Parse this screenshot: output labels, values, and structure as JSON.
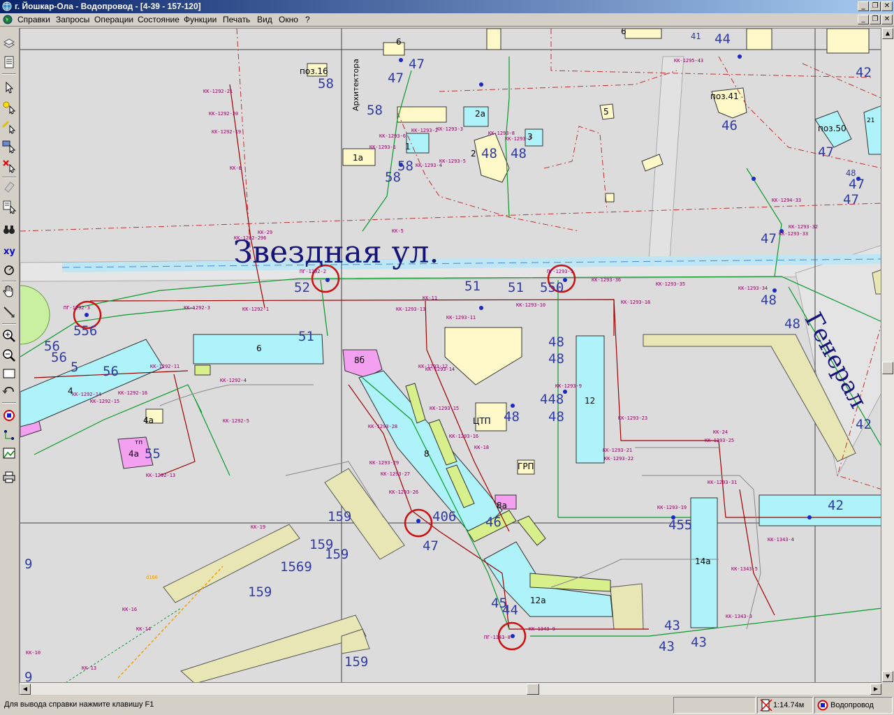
{
  "window": {
    "title": "г. Йошкар-Ола - Водопровод - [4-39 - 157-120]",
    "minimize_glyph": "_",
    "restore_glyph": "❐",
    "close_glyph": "✕"
  },
  "menu": {
    "items": [
      {
        "label": "Справки"
      },
      {
        "label": "Запросы"
      },
      {
        "label": "Операции"
      },
      {
        "label": "Состояние"
      },
      {
        "label": "Функции"
      },
      {
        "label": "Печать"
      },
      {
        "label": "Вид"
      },
      {
        "label": "Окно"
      },
      {
        "label": "?"
      }
    ]
  },
  "toolbar": {
    "tools": [
      {
        "name": "layers-tool-icon"
      },
      {
        "name": "document-tool-icon"
      },
      {
        "name": "pointer-tool-icon"
      },
      {
        "name": "select-point-tool-icon"
      },
      {
        "name": "select-line-tool-icon"
      },
      {
        "name": "select-area-tool-icon"
      },
      {
        "name": "select-delete-tool-icon"
      },
      {
        "name": "eraser-tool-icon"
      },
      {
        "name": "properties-tool-icon"
      },
      {
        "name": "binoculars-tool-icon"
      },
      {
        "name": "xy-coordinates-tool-icon",
        "text": "xy"
      },
      {
        "name": "measure-tool-icon"
      },
      {
        "name": "pan-hand-tool-icon"
      },
      {
        "name": "ruler-tool-icon"
      },
      {
        "name": "zoom-in-tool-icon"
      },
      {
        "name": "zoom-out-tool-icon"
      },
      {
        "name": "zoom-window-tool-icon"
      },
      {
        "name": "undo-zoom-tool-icon"
      },
      {
        "name": "network-node-tool-icon"
      },
      {
        "name": "network-trace-tool-icon"
      },
      {
        "name": "raster-image-tool-icon"
      },
      {
        "name": "print-tool-icon"
      }
    ]
  },
  "map": {
    "streets": [
      {
        "text": "Звездная ул."
      },
      {
        "text": "Генерал"
      },
      {
        "text": "Архитектора"
      }
    ],
    "buildings": [
      {
        "text": "6"
      },
      {
        "text": "6"
      },
      {
        "text": "поз.16"
      },
      {
        "text": "1а"
      },
      {
        "text": "1"
      },
      {
        "text": "2а"
      },
      {
        "text": "2"
      },
      {
        "text": "3"
      },
      {
        "text": "5"
      },
      {
        "text": "поз.41"
      },
      {
        "text": "поз.50"
      },
      {
        "text": "21"
      },
      {
        "text": "6"
      },
      {
        "text": "4"
      },
      {
        "text": "4а"
      },
      {
        "text": "4а"
      },
      {
        "text": "тп"
      },
      {
        "text": "8б"
      },
      {
        "text": "8"
      },
      {
        "text": "ЦТП"
      },
      {
        "text": "ГРП"
      },
      {
        "text": "8а"
      },
      {
        "text": "12"
      },
      {
        "text": "14а"
      },
      {
        "text": "12а"
      },
      {
        "text": "42"
      }
    ],
    "plot_numbers": [
      {
        "text": "47"
      },
      {
        "text": "47"
      },
      {
        "text": "58"
      },
      {
        "text": "58"
      },
      {
        "text": "58"
      },
      {
        "text": "48"
      },
      {
        "text": "48"
      },
      {
        "text": "46"
      },
      {
        "text": "47"
      },
      {
        "text": "47"
      },
      {
        "text": "47"
      },
      {
        "text": "47"
      },
      {
        "text": "52"
      },
      {
        "text": "51"
      },
      {
        "text": "51"
      },
      {
        "text": "550"
      },
      {
        "text": "48"
      },
      {
        "text": "48"
      },
      {
        "text": "48"
      },
      {
        "text": "48"
      },
      {
        "text": "448"
      },
      {
        "text": "48"
      },
      {
        "text": "48"
      },
      {
        "text": "42"
      },
      {
        "text": "51"
      },
      {
        "text": "56"
      },
      {
        "text": "556"
      },
      {
        "text": "56"
      },
      {
        "text": "5"
      },
      {
        "text": "56"
      },
      {
        "text": "55"
      },
      {
        "text": "159"
      },
      {
        "text": "159"
      },
      {
        "text": "159"
      },
      {
        "text": "1569"
      },
      {
        "text": "159"
      },
      {
        "text": "159"
      },
      {
        "text": "9"
      },
      {
        "text": "9"
      },
      {
        "text": "47"
      },
      {
        "text": "406"
      },
      {
        "text": "46"
      },
      {
        "text": "45"
      },
      {
        "text": "44"
      },
      {
        "text": "43"
      },
      {
        "text": "43"
      },
      {
        "text": "43"
      },
      {
        "text": "455"
      },
      {
        "text": "42"
      },
      {
        "text": "44"
      },
      {
        "text": "48"
      },
      {
        "text": "58"
      },
      {
        "text": "41"
      }
    ],
    "pipe_labels": [
      {
        "text": "КК-1292-21"
      },
      {
        "text": "КК-1292-20"
      },
      {
        "text": "КК-1292-19"
      },
      {
        "text": "КК-8"
      },
      {
        "text": "КК-1292-296"
      },
      {
        "text": "КК-29"
      },
      {
        "text": "КК-1292-3"
      },
      {
        "text": "КК-1292-1"
      },
      {
        "text": "КК-1293-13"
      },
      {
        "text": "КК-1293-12"
      },
      {
        "text": "КК-1293-11"
      },
      {
        "text": "КК-1293-10"
      },
      {
        "text": "КК-1293-18"
      },
      {
        "text": "КК-1293-36"
      },
      {
        "text": "КК-1293-35"
      },
      {
        "text": "КК-1293-34"
      },
      {
        "text": "КК-1293-9"
      },
      {
        "text": "КК-1293-23"
      },
      {
        "text": "КК-1293-22"
      },
      {
        "text": "КК-1293-25"
      },
      {
        "text": "КК-1293-31"
      },
      {
        "text": "КК-1293-19"
      },
      {
        "text": "КК-1343-3"
      },
      {
        "text": "КК-1343-4"
      },
      {
        "text": "КК-1343-9"
      },
      {
        "text": "КК-1292-14"
      },
      {
        "text": "КК-1292-15"
      },
      {
        "text": "КК-1292-16"
      },
      {
        "text": "КК-1292-11"
      },
      {
        "text": "КК-1292-5"
      },
      {
        "text": "КК-1292-4"
      },
      {
        "text": "КК-1292-13"
      },
      {
        "text": "КК-1293-28"
      },
      {
        "text": "КК-1293-29"
      },
      {
        "text": "КК-1293-27"
      },
      {
        "text": "КК-1293-26"
      },
      {
        "text": "КК-1293-14"
      },
      {
        "text": "КК-1293-15"
      },
      {
        "text": "КК-1293-16"
      },
      {
        "text": "КК-1293-21"
      },
      {
        "text": "КК-1293-1"
      },
      {
        "text": "КК-1293-2"
      },
      {
        "text": "КК-1293-3"
      },
      {
        "text": "КК-1293-4"
      },
      {
        "text": "КК-1293-5"
      },
      {
        "text": "КК-1293-6"
      },
      {
        "text": "КК-1293-7"
      },
      {
        "text": "КК-1293-8"
      },
      {
        "text": "КК-5"
      },
      {
        "text": "КК-11"
      },
      {
        "text": "КК-16"
      },
      {
        "text": "КК-18"
      },
      {
        "text": "КК-19"
      },
      {
        "text": "КК-24"
      },
      {
        "text": "КК-10"
      },
      {
        "text": "КК-13"
      },
      {
        "text": "КК-14"
      },
      {
        "text": "ПГ-1292-3"
      },
      {
        "text": "ПГ-1292-2"
      },
      {
        "text": "ПГ-1293-5"
      },
      {
        "text": "ПГ-1343-8"
      },
      {
        "text": "КК-1293-33"
      },
      {
        "text": "КК-1293-32"
      },
      {
        "text": "КК-1294-33"
      },
      {
        "text": "КК-1343-5"
      },
      {
        "text": "КК-1295-43"
      },
      {
        "text": "d160"
      }
    ]
  },
  "statusbar": {
    "hint": "Для вывода справки нажмите клавишу F1",
    "scale": "1:14.74м",
    "layer": "Водопровод"
  },
  "colors": {
    "title_start": "#0a246a",
    "title_end": "#a6caf0",
    "map_bg": "#dcdcdc",
    "building_cyan": "#aef2fa",
    "building_khaki": "#e8e6b4",
    "building_yellow": "#fff8c8",
    "building_pink": "#f4a0f0",
    "building_lime": "#d8f08c",
    "water_pipe_green": "#0a9a2a",
    "sewer_pipe_red": "#a00000",
    "label_blue": "#2e3aa8",
    "hydrant_circle_red": "#d01010"
  }
}
